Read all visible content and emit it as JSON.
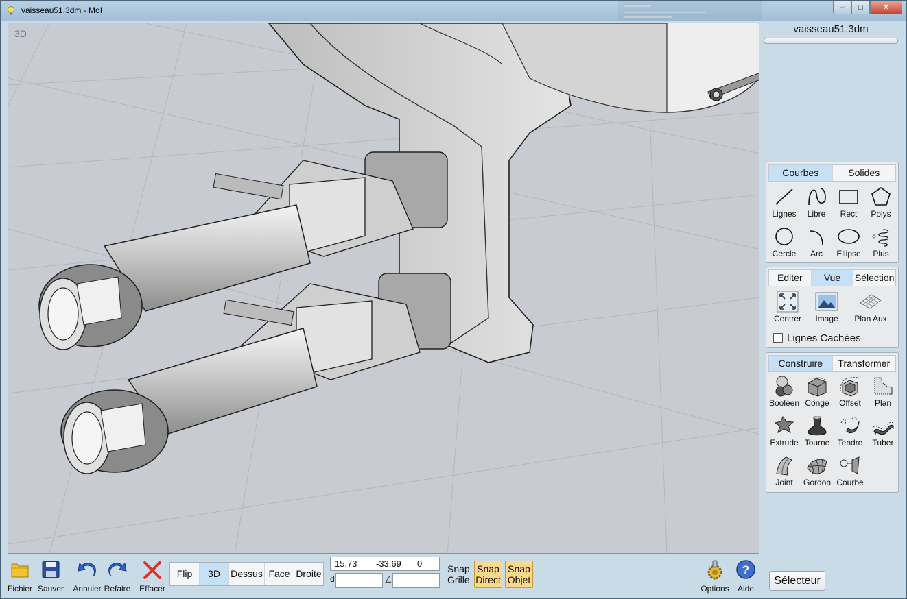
{
  "window": {
    "title": "vaisseau51.3dm - MoI",
    "controls": {
      "minimize": "minimize",
      "maximize": "maximize",
      "close": "close"
    }
  },
  "viewport": {
    "label": "3D"
  },
  "file": {
    "name": "vaisseau51.3dm"
  },
  "curves_panel": {
    "tabs": [
      "Courbes",
      "Solides"
    ],
    "active_tab": "Courbes",
    "tools": [
      {
        "label": "Lignes",
        "icon": "line-icon"
      },
      {
        "label": "Libre",
        "icon": "freehand-curve-icon"
      },
      {
        "label": "Rect",
        "icon": "rectangle-icon"
      },
      {
        "label": "Polys",
        "icon": "polygon-icon"
      },
      {
        "label": "Cercle",
        "icon": "circle-icon"
      },
      {
        "label": "Arc",
        "icon": "arc-icon"
      },
      {
        "label": "Ellipse",
        "icon": "ellipse-icon"
      },
      {
        "label": "Plus",
        "icon": "spiral-icon"
      }
    ]
  },
  "view_panel": {
    "tabs": [
      "Editer",
      "Vue",
      "Sélection"
    ],
    "active_tab": "Vue",
    "tools": [
      {
        "label": "Centrer",
        "icon": "zoom-extents-icon"
      },
      {
        "label": "Image",
        "icon": "background-image-icon"
      },
      {
        "label": "Plan Aux",
        "icon": "construction-plane-icon"
      }
    ],
    "hidden_lines_label": "Lignes Cachées",
    "hidden_lines_checked": false
  },
  "construct_panel": {
    "tabs": [
      "Construire",
      "Transformer"
    ],
    "active_tab": "Construire",
    "tools": [
      {
        "label": "Booléen",
        "icon": "boolean-icon"
      },
      {
        "label": "Congé",
        "icon": "fillet-icon"
      },
      {
        "label": "Offset",
        "icon": "offset-icon"
      },
      {
        "label": "Plan",
        "icon": "planar-icon"
      },
      {
        "label": "Extrude",
        "icon": "extrude-icon"
      },
      {
        "label": "Tourne",
        "icon": "revolve-icon"
      },
      {
        "label": "Tendre",
        "icon": "sweep-icon"
      },
      {
        "label": "Tuber",
        "icon": "pipe-icon"
      },
      {
        "label": "Joint",
        "icon": "loft-icon"
      },
      {
        "label": "Gordon",
        "icon": "network-surface-icon"
      },
      {
        "label": "Courbe",
        "icon": "project-curve-icon"
      }
    ]
  },
  "toolbar": {
    "file_label": "Fichier",
    "save_label": "Sauver",
    "undo_label": "Annuler",
    "redo_label": "Refaire",
    "delete_label": "Effacer",
    "views": [
      "Flip",
      "3D",
      "Dessus",
      "Face",
      "Droite"
    ],
    "active_view": "3D",
    "coord_x": "15,73",
    "coord_y": "-33,69",
    "coord_z": "0",
    "distance_label": "d",
    "angle_symbol": "∠",
    "snap_label_1": "Snap",
    "snap_label_2": "Grille",
    "snap_direct_1": "Snap",
    "snap_direct_2": "Direct",
    "snap_object_1": "Snap",
    "snap_object_2": "Objet",
    "options_label": "Options",
    "help_label": "Aide",
    "selector_label": "Sélecteur"
  },
  "colors": {
    "accent_tab": "#c6e0f5",
    "snap_active": "#fcd98a",
    "viewport_bg": "#c8ccd2",
    "delete_red": "#d93524",
    "undo_blue": "#2a62c4"
  }
}
